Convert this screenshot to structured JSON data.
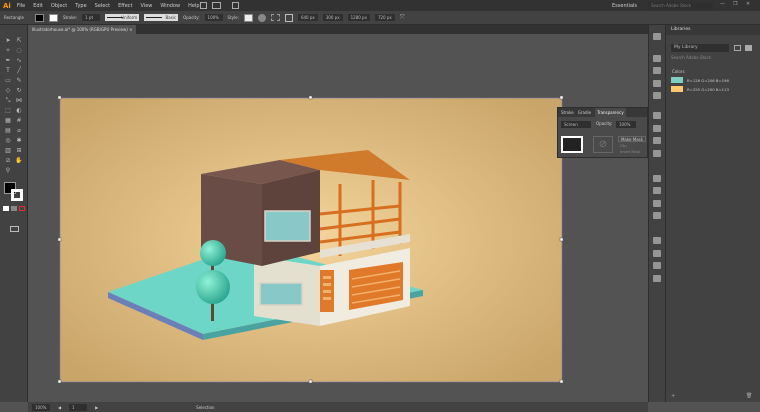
{
  "menu": {
    "logo": "Ai",
    "items": [
      "File",
      "Edit",
      "Object",
      "Type",
      "Select",
      "Effect",
      "View",
      "Window",
      "Help"
    ],
    "workspace": "Essentials",
    "search_placeholder": "Search Adobe Stock"
  },
  "control": {
    "selection_type": "Rectangle",
    "stroke_label": "Stroke:",
    "stroke_weight": "1 pt",
    "stroke_profile": "Uniform",
    "brush": "Basic",
    "opacity_label": "Opacity:",
    "opacity": "100%",
    "style_label": "Style:",
    "x": "640 px",
    "y": "300 px",
    "w": "1280 px",
    "h": "720 px"
  },
  "document": {
    "tab_title": "Illustratorhouse.ai* @ 100% (RGB/GPU Preview)",
    "close": "×"
  },
  "transparency_panel": {
    "tabs": [
      "Stroke",
      "Gradie",
      "Transparency"
    ],
    "blend_mode": "Screen",
    "opacity_label": "Opacity:",
    "opacity": "100%",
    "make_mask": "Make Mask",
    "clip": "Clip",
    "invert_mask": "Invert Mask"
  },
  "libraries": {
    "title": "Libraries",
    "library": "My Library",
    "search_placeholder": "Search Adobe Stock",
    "section": "Colors",
    "colors": [
      {
        "label": "R=126 G=206 B=196",
        "hex": "#7ecec4"
      },
      {
        "label": "R=255 G=200 B=113",
        "hex": "#ffc871"
      }
    ]
  },
  "status": {
    "zoom": "100%",
    "artboard": "1",
    "tool": "Selection"
  }
}
